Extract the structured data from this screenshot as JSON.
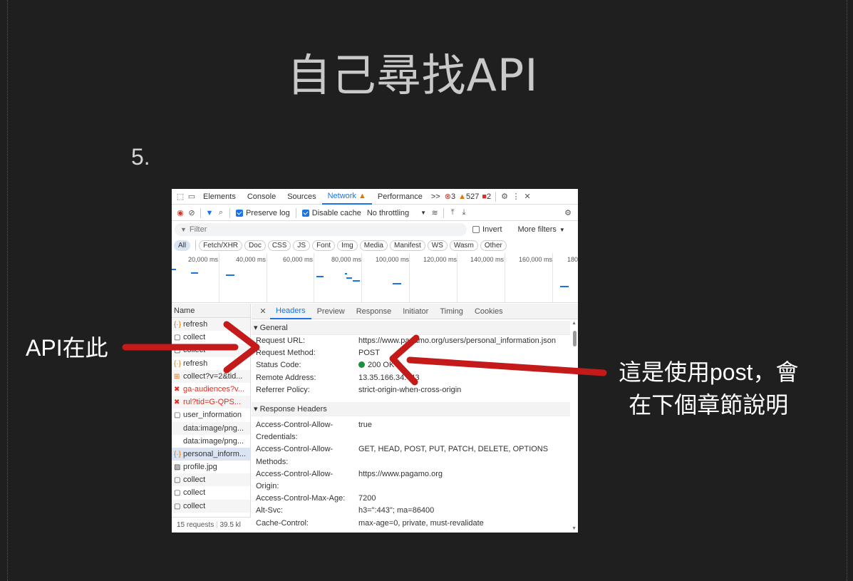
{
  "slide": {
    "title": "自己尋找API",
    "step_number": "5.",
    "annotation_left": "API在此",
    "annotation_right_line1": "這是使用post，會",
    "annotation_right_line2": "在下個章節說明"
  },
  "devtools": {
    "tabs": [
      "Elements",
      "Console",
      "Sources",
      "Network",
      "Performance"
    ],
    "active_tab": "Network",
    "overflow": ">>",
    "error_count": "3",
    "warning_count": "527",
    "issue_count": "2",
    "toolbar": {
      "preserve_log": "Preserve log",
      "disable_cache": "Disable cache",
      "throttling": "No throttling"
    },
    "filter": {
      "placeholder": "Filter",
      "invert": "Invert",
      "more_filters": "More filters"
    },
    "type_filters": [
      "All",
      "Fetch/XHR",
      "Doc",
      "CSS",
      "JS",
      "Font",
      "Img",
      "Media",
      "Manifest",
      "WS",
      "Wasm",
      "Other"
    ],
    "timeline_ticks": [
      "20,000 ms",
      "40,000 ms",
      "60,000 ms",
      "80,000 ms",
      "100,000 ms",
      "120,000 ms",
      "140,000 ms",
      "160,000 ms",
      "180"
    ],
    "name_header": "Name",
    "requests": [
      {
        "name": "refresh",
        "icon": "{·}",
        "status": "normal"
      },
      {
        "name": "collect",
        "icon": "▢",
        "status": "normal"
      },
      {
        "name": "collect",
        "icon": "▢",
        "status": "normal"
      },
      {
        "name": "refresh",
        "icon": "{·}",
        "status": "normal"
      },
      {
        "name": "collect?v=2&tid...",
        "icon": "⊞",
        "status": "normal"
      },
      {
        "name": "ga-audiences?v...",
        "icon": "✖",
        "status": "error"
      },
      {
        "name": "rul?tid=G-QPS...",
        "icon": "✖",
        "status": "error"
      },
      {
        "name": "user_information",
        "icon": "▢",
        "status": "normal"
      },
      {
        "name": "data:image/png...",
        "icon": "",
        "status": "normal"
      },
      {
        "name": "data:image/png...",
        "icon": "",
        "status": "normal"
      },
      {
        "name": "personal_inform...",
        "icon": "{·}",
        "status": "selected"
      },
      {
        "name": "profile.jpg",
        "icon": "▨",
        "status": "normal"
      },
      {
        "name": "collect",
        "icon": "▢",
        "status": "normal"
      },
      {
        "name": "collect",
        "icon": "▢",
        "status": "normal"
      },
      {
        "name": "collect",
        "icon": "▢",
        "status": "normal"
      }
    ],
    "footer": {
      "requests": "15 requests",
      "size": "39.5 kl"
    },
    "detail_tabs": [
      "Headers",
      "Preview",
      "Response",
      "Initiator",
      "Timing",
      "Cookies"
    ],
    "active_detail_tab": "Headers",
    "general": {
      "title": "▾ General",
      "rows": [
        {
          "key": "Request URL:",
          "value": "https://www.pagamo.org/users/personal_information.json"
        },
        {
          "key": "Request Method:",
          "value": "POST"
        },
        {
          "key": "Status Code:",
          "value": "200 OK"
        },
        {
          "key": "Remote Address:",
          "value": "13.35.166.34:443"
        },
        {
          "key": "Referrer Policy:",
          "value": "strict-origin-when-cross-origin"
        }
      ]
    },
    "response_headers": {
      "title": "▾ Response Headers",
      "rows": [
        {
          "key": "Access-Control-Allow-",
          "value": "true"
        },
        {
          "key": "Credentials:",
          "value": ""
        },
        {
          "key": "Access-Control-Allow-",
          "value": "GET, HEAD, POST, PUT, PATCH, DELETE, OPTIONS"
        },
        {
          "key": "Methods:",
          "value": ""
        },
        {
          "key": "Access-Control-Allow-",
          "value": "https://www.pagamo.org"
        },
        {
          "key": "Origin:",
          "value": ""
        },
        {
          "key": "Access-Control-Max-Age:",
          "value": "7200"
        },
        {
          "key": "Alt-Svc:",
          "value": "h3=\":443\"; ma=86400"
        },
        {
          "key": "Cache-Control:",
          "value": "max-age=0, private, must-revalidate"
        }
      ]
    }
  }
}
